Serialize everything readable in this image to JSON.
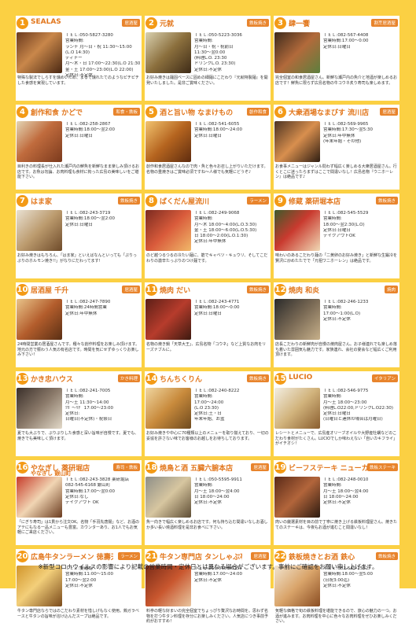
{
  "cards": [
    {
      "num": "1",
      "name": "SEALAS",
      "tag": "居酒屋",
      "lines": [
        "ＴＥＬ:050-5827-3280",
        "営業時間:",
        "ランチ 月〜日・祝 11:30〜15:00",
        "(L.O 14:30)",
        "ディナー",
        "月〜木・日 17:00〜22:30(L.O 21:30)",
        "金・土 17:00〜23:00(L.O 22:00)",
        "定休日:不定休"
      ],
      "desc": "特殊な製法でしらすを燻めいため、まるで燻れたてのようなピチピチした食感を実現しています。"
    },
    {
      "num": "2",
      "name": "元就",
      "tag": "鉄板焼き",
      "lines": [
        "ＴＥＬ:050-5223-3036",
        "営業時間:",
        "月〜日・祝・祝前日",
        "11:30〜翌0:00",
        "(料理L.O. 23:30",
        "ドリンクL.O. 23:30)",
        "定休日:不定休"
      ],
      "desc": "お好み焼きは麺固ベースに固めの細麺にこだわり『元就特製麺』を開発いたしました。是非ご賞味ください。"
    },
    {
      "num": "3",
      "name": "肆一饗",
      "tag": "割烹居酒屋",
      "lines": [
        "ＴＥＬ:082-567-4408",
        "営業時間:17:00〜0:00",
        "定休日:日曜日"
      ],
      "desc": "完全個室の和食居酒屋さん。新鮮な瀬戸内の魚介と地酒が楽しめるお店です！鮮魚に限らず広島名物の牛コウネ炙り寿司も楽しめます。"
    },
    {
      "num": "4",
      "name": "創作和食 かどで",
      "tag": "和食・鉄板",
      "lines": [
        "ＴＥＬ:082-258-2867",
        "営業時間:18:00〜翌2:00",
        "定休日:日曜日"
      ],
      "desc": "目利きの料理長が仕入れた瀬戸内の鮮魚を新鮮なまま楽しみ頂けるお店です。お魚は勿論、お肉料理も食材に拘った広島の美味しいをご堪能下さい。"
    },
    {
      "num": "5",
      "name": "酒と旨い物 なまけもの",
      "tag": "創作和食",
      "lines": [
        "ＴＥＬ:082-541-6055",
        "営業時間:18:00〜24:00",
        "定休日:日曜日"
      ],
      "desc": "創作和食居酒屋さんなので肉・魚と色々お召し上がりいただけます。名物の重焼きはご賞味必須ですね〜人様でも気軽にどうぞ♪"
    },
    {
      "num": "6",
      "name": "大衆酒場なまびす 流川店",
      "tag": "居酒屋",
      "lines": [
        "ＴＥＬ:082-569-9965",
        "営業時間:17:30〜翌5:30",
        "定休日:年中無休",
        "(年末年始・その他)"
      ],
      "desc": "お食事メニューはジャンル問わず幅広く楽しめる大衆居酒屋さん。行くとこに迷ったらまずはここで間違いなし！広島名物『ウニホーレン』は絶品です♪"
    },
    {
      "num": "7",
      "name": "はま家",
      "tag": "鉄板焼き",
      "lines": [
        "ＴＥＬ:082-243-3719",
        "営業時間:18:00〜翌2:00",
        "定休日:日曜日"
      ],
      "desc": "お好み焼きはもちろん、「はま家」といえばなんといっても「ぷりっぷりのホルモン焼き!!」がなりにだわってます!"
    },
    {
      "num": "8",
      "name": "ばくだん屋流川",
      "tag": "ラーメン",
      "lines": [
        "ＴＥＬ:082-249-9068",
        "営業時間:",
        "月〜木 18:00〜4:00(L.O.3:30)",
        "金・土 18:00〜6:00(L.O.5:30)",
        "日 18:00〜2:00(L.O.1:30)",
        "定休日:年中無休"
      ],
      "desc": "のど越つるつるの冷たい麺に、筋でキャベツ・キュウリ、そしてこだわりの激辛たっぷりのつけ麺です。"
    },
    {
      "num": "9",
      "name": "修蔵 薬研堀本店",
      "tag": "鉄板焼き",
      "lines": [
        "ＴＥＬ:082-545-5529",
        "営業時間:",
        "18:00〜翌2:30(L.O)",
        "定休日:日曜日",
        "テイクアウトOK"
      ],
      "desc": "味わいのあるこだわり麺の「二黄卵のお好み焼き」と新鮮な生鍛冷を賢沢に炒めたたでで「元祖ワニホーレン」は絶品です。"
    },
    {
      "num": "10",
      "name": "居酒屋 千升",
      "tag": "居酒屋",
      "lines": [
        "ＴＥＬ:082-247-7890",
        "営業時間:24時間営業",
        "定休日:年中無休"
      ],
      "desc": "24時間営業の居酒屋さんです。種々な創作料理をお楽しみ頂けます。地元の方で賑わう人気の有名店です。時間を気にせずゆっくりお楽しみ下さい！"
    },
    {
      "num": "11",
      "name": "焼肉 だい",
      "tag": "鉄板焼き",
      "lines": [
        "ＴＥＬ:082-243-4771",
        "営業時間:18:00〜0:00",
        "定休日:日曜日"
      ],
      "desc": "名物の焼き鍋「天草大王」、広島名物「コウネ」など上質なお肉をリーズナブルに。"
    },
    {
      "num": "12",
      "name": "焼肉 和炎",
      "tag": "焼肉",
      "lines": [
        "ＴＥＬ:082-246-1233",
        "営業時間:",
        "17:00〜1:00(L.O)",
        "定休日:不定休"
      ],
      "desc": "店長こだわりの新鮮肉が自慢の焼肉屋さん。お子様連れでも楽しめ落ち着いた雰囲気も魅力です。家族連れ、会社の宴会など幅広くご利用頂けます。"
    },
    {
      "num": "13",
      "name": "かき忠ハウス",
      "tag": "かき料理",
      "lines": [
        "ＴＥＬ:082-241-7005",
        "営業時間:",
        "月〜土 11:30〜14:00",
        "ﾂﾎﾞ〜ﾘﾁﾞ 17:00〜23:00",
        "定休日:",
        "日曜日(不定休)・祝祭日"
      ],
      "desc": "夏でも大ぶりで、ぷりぷりした食感と深い旨味が自慢です。夏でも、焼きでも美味しく頂けます。"
    },
    {
      "num": "14",
      "name": "ちんちくりん",
      "tag": "鉄板焼き",
      "lines": [
        "ＴＥＬ:082-240-8222",
        "営業時間:",
        "17:00〜24:00",
        "(L.O 23:30)",
        "定休日:土・日",
        "年末年始、お盆"
      ],
      "desc": "お好み焼きや中心に70種類以上のメニューを取り揃えており、一切の妥協を許さない味でお客様のお越しをお待ちしております。"
    },
    {
      "num": "15",
      "name": "LUCIO",
      "tag": "イタリアン",
      "lines": [
        "ＴＥＬ:082-546-9775",
        "営業時間:",
        "月〜土 18:00〜23:00",
        "(料理L.O22:00,ドリンクL.O22:30)",
        "定休日:日曜日",
        "(日曜日と連休の場合は月曜日)"
      ],
      "desc": "レシートとメニューで、広島産オリーブオイルや大野産牡蠣などのこだわり食材がたくさん。LUCIOでしか味わえない「自いカキフライ」がイチオシ！"
    },
    {
      "num": "16",
      "name": "やなぎし 薬研堀店",
      "tag": "寿司・鉄板",
      "lines": [
        "ＴＥＬ:082-243-3828 薬研堀店",
        "082-545-6168 銀山町",
        "営業時間:17:00〜翌0:00",
        "定休日:なし",
        "テイクアウト OK"
      ],
      "desc": "「にぎり寿司」は1貫から注文OK。名物「手羽先唐揚」など、お酒のアテにもなる一品メニューも豊富。カウンターあり、お1人でもお気軽にご来店ください。",
      "sub": "やなぎし 銀山町"
    },
    {
      "num": "18",
      "name": "焼鳥と酒 五臓六腑本店",
      "tag": "居酒屋",
      "lines": [
        "ＴＥＬ:050-5595-9911",
        "営業時間:",
        "月〜土 18:00〜翌4:00",
        "日 18:00〜24:00",
        "定休日:不定休"
      ],
      "desc": "魚一向きで幅広く楽しめるお店です。何も持ち込む間違いなしお酒しか多い長い燒酒料理を是非お食べに下さい。"
    },
    {
      "num": "19",
      "name": "ビーフステーキ ニューカルネ",
      "tag": "鉄板ステーキ",
      "lines": [
        "ＴＥＬ:082-248-0010",
        "営業時間:",
        "月〜土 18:00〜翌4:00",
        "日 18:00〜24:00",
        "定休日:不定休"
      ],
      "desc": "肉いの厳選素材を目の前で丁寧に焼き上げる鉄板料理屋さん。焼きたてのステーキは、今夜もお酒が進むこと間違いなし！"
    },
    {
      "num": "20",
      "name": "広島牛タンラーメン 徳壽天",
      "tag": "ラーメン",
      "lines": [
        "ＴＥＬ:要確認",
        "営業時間:11:00〜15:00",
        "17:00〜翌2:00",
        "定休日:不定休"
      ],
      "desc": "牛タン専門店ならではのこだわり素材を惜しげもなく使用。鶏ガラベースと牛タンの旨味が溶け込んだスープは絶品です。"
    },
    {
      "num": "21",
      "name": "牛タン専門店 タンしゃぶ亭",
      "tag": "居酒屋",
      "lines": [
        "ＴＥＬ:050-5486-6154",
        "営業時間:17:00〜24:00",
        "定休日:不定休"
      ],
      "desc": "料亭の軽な好まいの完全個室でちょっぴり贅沢なお時間を。思わず名物を打つ牛タン料理を存分にお楽しみください。人気店につき事前予約がおすすめ！"
    },
    {
      "num": "22",
      "name": "鉄板焼きとお酒 鉄心",
      "tag": "鉄板焼き",
      "lines": [
        "ＴＥＬ:082-545-1532",
        "営業時間:18:00〜翌5:00",
        "(日祝3:00迄)",
        "定休日:不定休"
      ],
      "desc": "気軽な価格で旬の鉄板料理を堪能できるので、旅心の魅力の一つ。お酒が進みます。お肉料理を中心に色々なお肉料理をぜひお楽しみください。"
    }
  ],
  "footer": "※新型コロナウイルスの影響により記載の営業時間・定休日とは異なる場合がございます。事前にご確認をお願い申し上げます。"
}
